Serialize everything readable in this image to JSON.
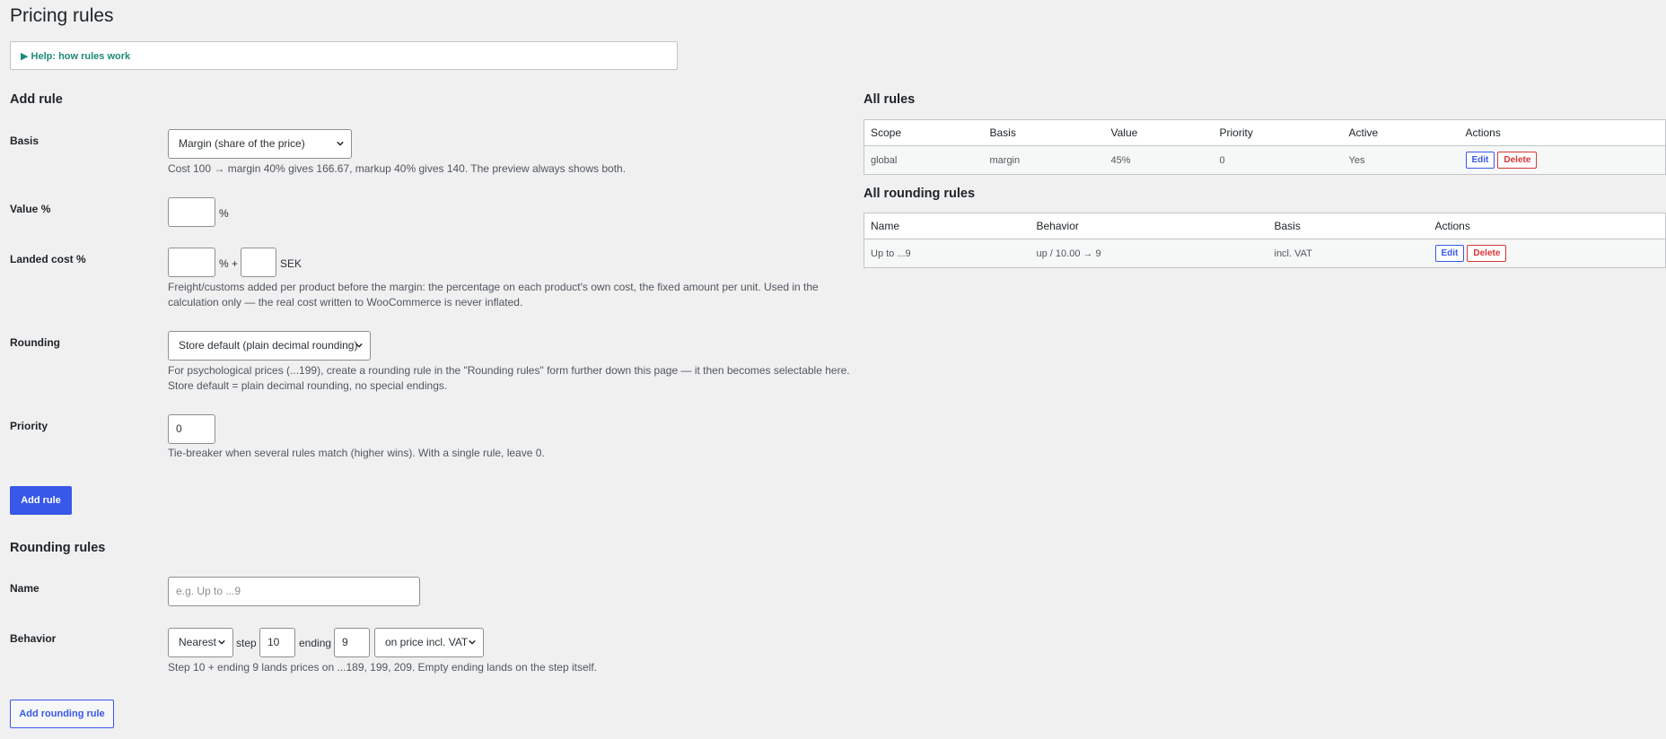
{
  "page": {
    "title": "Pricing rules"
  },
  "help": {
    "summary": "▶ Help: how rules work"
  },
  "add_rule": {
    "heading": "Add rule",
    "basis": {
      "label": "Basis",
      "value": "Margin (share of the price)",
      "description": "Cost 100 → margin 40% gives 166.67, markup 40% gives 140. The preview always shows both."
    },
    "value": {
      "label": "Value %",
      "value": "",
      "unit": "%"
    },
    "landed": {
      "label": "Landed cost %",
      "percent_value": "",
      "percent_unit": "% +",
      "fixed_value": "",
      "currency": "SEK",
      "description_1": "Freight/customs added per product before the margin: the percentage on each product's own cost, the fixed amount per unit. Used in the",
      "description_2": "calculation only — the real cost written to WooCommerce is never inflated."
    },
    "rounding": {
      "label": "Rounding",
      "value": "Store default (plain decimal rounding)",
      "description_1": "For psychological prices (...199), create a rounding rule in the \"Rounding rules\" form further down this page — it then becomes selectable here.",
      "description_2": "Store default = plain decimal rounding, no special endings."
    },
    "priority": {
      "label": "Priority",
      "value": "0",
      "description": "Tie-breaker when several rules match (higher wins). With a single rule, leave 0."
    },
    "submit": "Add rule"
  },
  "rounding_rules": {
    "heading": "Rounding rules",
    "name": {
      "label": "Name",
      "placeholder": "e.g. Up to ...9"
    },
    "behavior": {
      "label": "Behavior",
      "mode": "Nearest",
      "step_label": "step",
      "step_value": "10",
      "ending_label": "ending",
      "ending_value": "9",
      "basis": "on price incl. VAT",
      "description": "Step 10 + ending 9 lands prices on ...189, 199, 209. Empty ending lands on the step itself."
    },
    "submit": "Add rounding rule"
  },
  "all_rules": {
    "heading": "All rules",
    "columns": [
      "Scope",
      "Basis",
      "Value",
      "Priority",
      "Active",
      "Actions"
    ],
    "rows": [
      {
        "scope": "global",
        "basis": "margin",
        "value": "45%",
        "priority": "0",
        "active": "Yes",
        "edit": "Edit",
        "delete": "Delete"
      }
    ]
  },
  "all_rounding_rules": {
    "heading": "All rounding rules",
    "columns": [
      "Name",
      "Behavior",
      "Basis",
      "Actions"
    ],
    "rows": [
      {
        "name": "Up to ...9",
        "behavior": "up / 10.00 → 9",
        "basis": "incl. VAT",
        "edit": "Edit",
        "delete": "Delete"
      }
    ]
  },
  "colors": {
    "accent": "#3858e9",
    "danger": "#d63638",
    "help_link": "#1e8a7a",
    "background": "#f0f0f1"
  },
  "icons": {
    "select_arrow": "chevron-down-icon",
    "help_toggle": "triangle-right-icon"
  }
}
